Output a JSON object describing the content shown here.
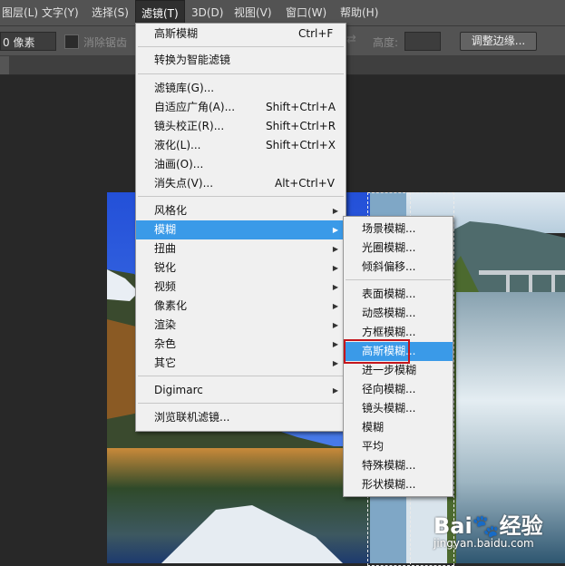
{
  "menubar": {
    "items": [
      "图层(L)",
      "文字(Y)",
      "选择(S)",
      "滤镜(T)",
      "3D(D)",
      "视图(V)",
      "窗口(W)",
      "帮助(H)"
    ]
  },
  "options": {
    "feather_value": "0 像素",
    "antialias_label": "消除锯齿",
    "height_label": "高度:",
    "refine_edge_button": "调整边缘..."
  },
  "filter_menu": {
    "items": [
      {
        "label": "高斯模糊",
        "shortcut": "Ctrl+F"
      },
      {
        "label": "转换为智能滤镜"
      },
      {
        "label": "滤镜库(G)..."
      },
      {
        "label": "自适应广角(A)...",
        "shortcut": "Shift+Ctrl+A"
      },
      {
        "label": "镜头校正(R)...",
        "shortcut": "Shift+Ctrl+R"
      },
      {
        "label": "液化(L)...",
        "shortcut": "Shift+Ctrl+X"
      },
      {
        "label": "油画(O)..."
      },
      {
        "label": "消失点(V)...",
        "shortcut": "Alt+Ctrl+V"
      },
      {
        "label": "风格化"
      },
      {
        "label": "模糊"
      },
      {
        "label": "扭曲"
      },
      {
        "label": "锐化"
      },
      {
        "label": "视频"
      },
      {
        "label": "像素化"
      },
      {
        "label": "渲染"
      },
      {
        "label": "杂色"
      },
      {
        "label": "其它"
      },
      {
        "label": "Digimarc"
      },
      {
        "label": "浏览联机滤镜..."
      }
    ]
  },
  "blur_submenu": {
    "items": [
      "场景模糊...",
      "光圈模糊...",
      "倾斜偏移...",
      "表面模糊...",
      "动感模糊...",
      "方框模糊...",
      "高斯模糊...",
      "进一步模糊",
      "径向模糊...",
      "镜头模糊...",
      "模糊",
      "平均",
      "特殊模糊...",
      "形状模糊..."
    ]
  },
  "watermark": {
    "logo_text": "Bai🐾经验",
    "url": "jingyan.baidu.com"
  },
  "colors": {
    "highlight": "#3a9ae8",
    "callout": "#c4161c"
  }
}
